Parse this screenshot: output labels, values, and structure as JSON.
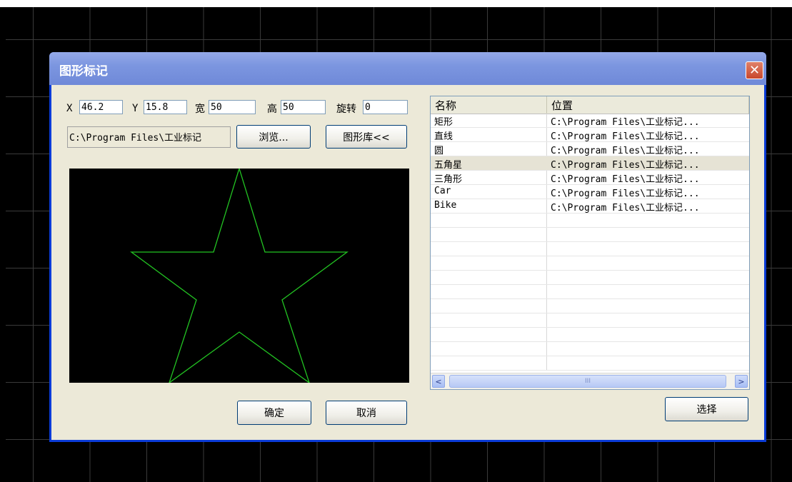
{
  "dialog": {
    "title": "图形标记",
    "close_symbol": "✕"
  },
  "fields": {
    "x_label": "X",
    "x_value": "46.2",
    "y_label": "Y",
    "y_value": "15.8",
    "width_label": "宽",
    "width_value": "50",
    "height_label": "高",
    "height_value": "50",
    "rotate_label": "旋转",
    "rotate_value": "0"
  },
  "path_display": "C:\\Program Files\\工业标记",
  "buttons": {
    "browse": "浏览...",
    "library": "图形库<<",
    "ok": "确定",
    "cancel": "取消",
    "select": "选择"
  },
  "preview": {
    "shape": "star",
    "stroke_color": "#22c322",
    "background": "#000000"
  },
  "list": {
    "columns": [
      "名称",
      "位置"
    ],
    "selected_index": 3,
    "rows": [
      {
        "name": "矩形",
        "path": "C:\\Program Files\\工业标记..."
      },
      {
        "name": "直线",
        "path": "C:\\Program Files\\工业标记..."
      },
      {
        "name": "圆",
        "path": "C:\\Program Files\\工业标记..."
      },
      {
        "name": "五角星",
        "path": "C:\\Program Files\\工业标记..."
      },
      {
        "name": "三角形",
        "path": "C:\\Program Files\\工业标记..."
      },
      {
        "name": "Car",
        "path": "C:\\Program Files\\工业标记..."
      },
      {
        "name": "Bike",
        "path": "C:\\Program Files\\工业标记..."
      }
    ],
    "scrollbar": {
      "left": "<",
      "right": ">",
      "grip": "III"
    }
  }
}
